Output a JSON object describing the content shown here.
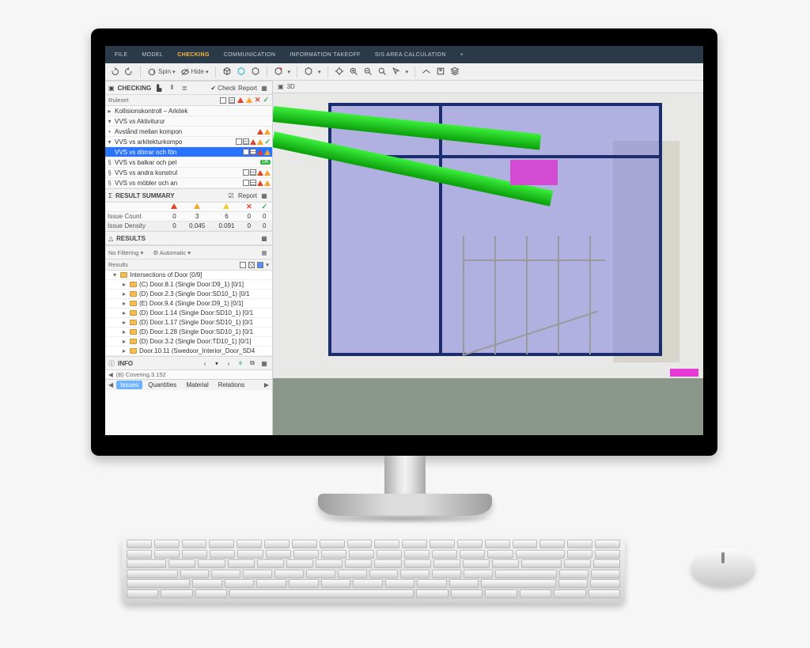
{
  "menu": {
    "items": [
      "FILE",
      "MODEL",
      "CHECKING",
      "COMMUNICATION",
      "INFORMATION TAKEOFF",
      "SIS AREA CALCULATION"
    ],
    "active_index": 2,
    "plus": "+"
  },
  "toolbar": {
    "spin": "Spin",
    "hide": "Hide"
  },
  "viewport": {
    "label": "3D"
  },
  "panels": {
    "checking": {
      "title": "CHECKING",
      "check_btn": "Check",
      "report_btn": "Report",
      "ruleset_label": "Ruleset",
      "tree": [
        {
          "caret": "▸",
          "indent": 1,
          "label": "Kollisionskontroll – Arkitek",
          "status": []
        },
        {
          "caret": "▾",
          "indent": 1,
          "label": "VVS vs Aktiviturur",
          "status": []
        },
        {
          "caret": "•",
          "indent": 2,
          "label": "Avstånd mellan kompon",
          "status": [
            "tri-red",
            "tri-or"
          ]
        },
        {
          "caret": "▾",
          "indent": 2,
          "label": "VVS vs arkitekturkompo",
          "status": [
            "sq",
            "grid",
            "tri-red",
            "tri-or",
            "tick"
          ]
        },
        {
          "caret": "",
          "indent": 3,
          "label": "VVS vs dörrar och fön",
          "sel": true,
          "status": [
            "sq",
            "grid",
            "tri-red",
            "tri-or"
          ]
        },
        {
          "caret": "§",
          "indent": 3,
          "label": "VVS vs balkar och pel",
          "status": [
            "ok"
          ]
        },
        {
          "caret": "§",
          "indent": 3,
          "label": "VVS vs andra konstrul",
          "status": [
            "sq",
            "grid",
            "tri-red",
            "tri-or"
          ]
        },
        {
          "caret": "§",
          "indent": 3,
          "label": "VVS vs möbler och an",
          "status": [
            "sq",
            "grid",
            "tri-red",
            "tri-or"
          ]
        }
      ]
    },
    "summary": {
      "title": "RESULT SUMMARY",
      "report_btn": "Report",
      "cols": [
        "",
        "△",
        "△",
        "△",
        "✕",
        "✓"
      ],
      "rows": [
        {
          "label": "Issue Count",
          "vals": [
            "0",
            "3",
            "6",
            "0",
            "0"
          ]
        },
        {
          "label": "Issue Density",
          "vals": [
            "0",
            "0.045",
            "0.091",
            "0",
            "0"
          ]
        }
      ]
    },
    "results": {
      "title": "RESULTS",
      "filter": "No Filtering",
      "mode": "Automatic",
      "header": "Results",
      "items": [
        "Intersections of Door [0/9]",
        "(C) Door.8.1 (Single Door:D9_1) [0/1]",
        "(D) Door.2.3 (Single Door:SD10_1) [0/1",
        "(E) Door.9.4 (Single Door:D9_1) [0/1]",
        "(D) Door.1.14 (Single Door:SD10_1) [0/1",
        "(D) Door.1.17 (Single Door:SD10_1) [0/1",
        "(D) Door.1.28 (Single Door:SD10_1) [0/1",
        "(D) Door.3.2 (Single Door:TD10_1) [0/1]",
        "Door.10.11 (Swedoor_Interior_Door_SD4"
      ]
    },
    "info": {
      "title": "INFO",
      "breadcrumb": "(B) Covering.3.152",
      "tabs": [
        "Issues",
        "Quantities",
        "Material",
        "Relations"
      ],
      "active_tab": 0
    }
  }
}
